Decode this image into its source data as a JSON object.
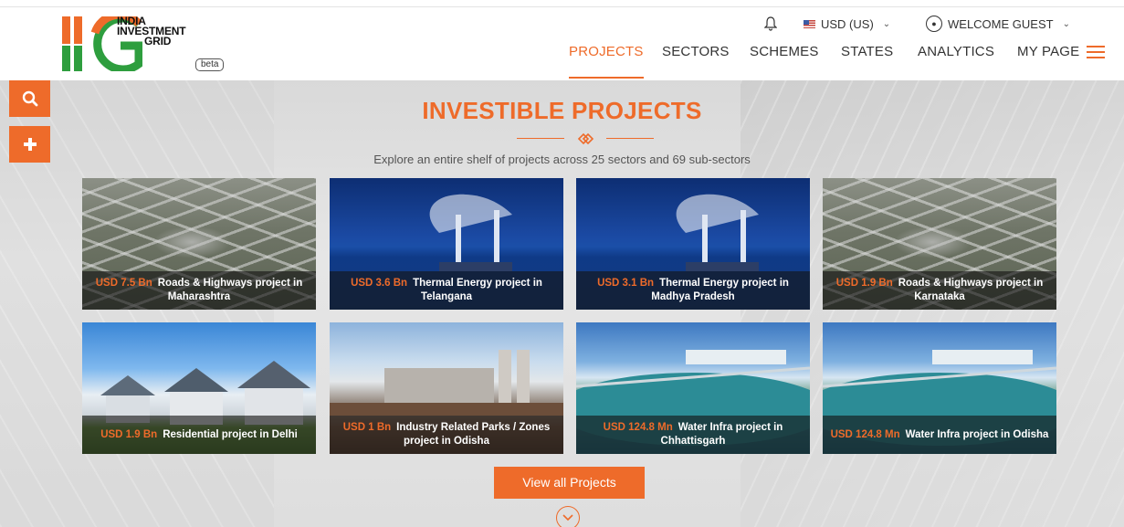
{
  "brand": {
    "logo_lines": [
      "INDIA",
      "INVESTMENT",
      "GRID"
    ],
    "beta_label": "beta",
    "colors": {
      "orange": "#ee6b2a",
      "green": "#2e9e3e"
    }
  },
  "utility": {
    "bell_icon": "bell-icon",
    "currency_label": "USD (US)",
    "currency_flag": "us-flag-icon",
    "welcome_label": "WELCOME GUEST"
  },
  "nav": {
    "items": [
      {
        "label": "PROJECTS",
        "active": true
      },
      {
        "label": "SECTORS",
        "active": false
      },
      {
        "label": "SCHEMES",
        "active": false
      },
      {
        "label": "STATES",
        "active": false
      },
      {
        "label": "ANALYTICS",
        "active": false
      },
      {
        "label": "MY PAGE",
        "active": false
      }
    ],
    "menu_icon": "hamburger-icon"
  },
  "sidebar": {
    "buttons": [
      "search-icon",
      "plus-icon"
    ]
  },
  "section": {
    "title": "INVESTIBLE PROJECTS",
    "subtitle": "Explore an entire shelf of projects across 25 sectors and 69 sub-sectors"
  },
  "projects": [
    {
      "amount": "USD 7.5 Bn",
      "name": "Roads & Highways project in Maharashtra",
      "image": "road"
    },
    {
      "amount": "USD 3.6 Bn",
      "name": "Thermal Energy project in Telangana",
      "image": "thermal"
    },
    {
      "amount": "USD 3.1 Bn",
      "name": "Thermal Energy project in Madhya Pradesh",
      "image": "thermal"
    },
    {
      "amount": "USD 1.9 Bn",
      "name": "Roads & Highways project in Karnataka",
      "image": "road"
    },
    {
      "amount": "USD 1.9 Bn",
      "name": "Residential project in Delhi",
      "image": "house"
    },
    {
      "amount": "USD 1 Bn",
      "name": "Industry Related Parks / Zones project in Odisha",
      "image": "industry"
    },
    {
      "amount": "USD 124.8 Mn",
      "name": "Water Infra project in Chhattisgarh",
      "image": "water"
    },
    {
      "amount": "USD 124.8 Mn",
      "name": "Water Infra project in Odisha",
      "image": "water"
    }
  ],
  "cta": {
    "view_all_label": "View all Projects",
    "scroll_icon": "chevron-down-icon"
  }
}
